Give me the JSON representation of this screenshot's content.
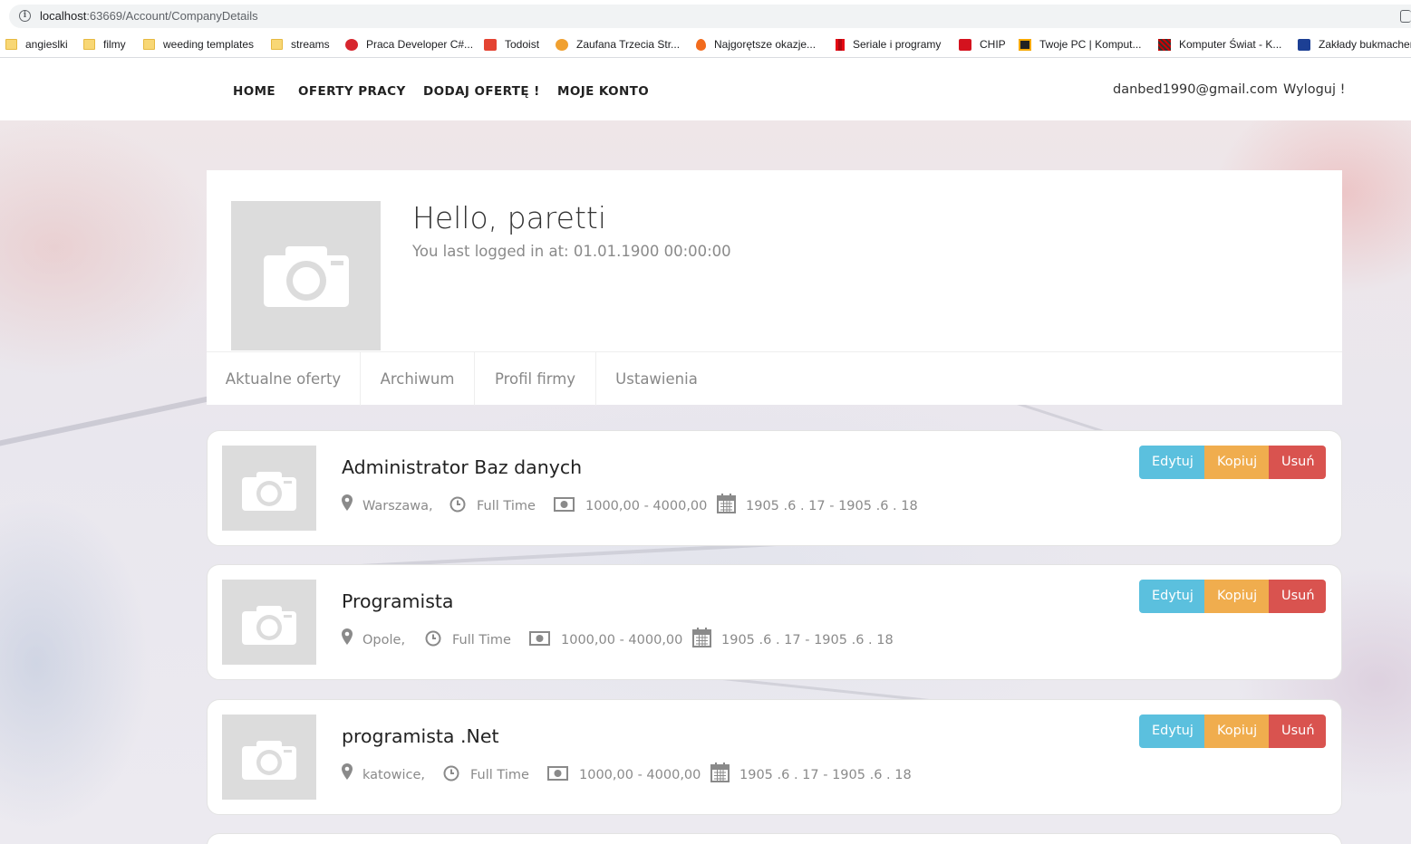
{
  "browser": {
    "url_host": "localhost",
    "url_rest": ":63669/Account/CompanyDetails",
    "bookmarks": [
      {
        "label": "angieslki",
        "icon": "folder-icon"
      },
      {
        "label": "filmy",
        "icon": "folder-icon"
      },
      {
        "label": "weeding templates",
        "icon": "folder-icon"
      },
      {
        "label": "streams",
        "icon": "folder-icon"
      },
      {
        "label": "Praca Developer C#...",
        "icon": "praca-favicon"
      },
      {
        "label": "Todoist",
        "icon": "todoist-favicon"
      },
      {
        "label": "Zaufana Trzecia Str...",
        "icon": "shield-favicon"
      },
      {
        "label": "Najgorętsze okazje...",
        "icon": "flame-favicon"
      },
      {
        "label": "Seriale i programy",
        "icon": "netflix-favicon"
      },
      {
        "label": "CHIP",
        "icon": "chip-favicon"
      },
      {
        "label": "Twoje PC | Komput...",
        "icon": "twojepc-favicon"
      },
      {
        "label": "Komputer Świat - K...",
        "icon": "komputerswiat-favicon"
      },
      {
        "label": "Zakłady bukmacher",
        "icon": "sts-favicon"
      }
    ]
  },
  "nav": {
    "home": "HOME",
    "offers": "OFERTY PRACY",
    "add_offer": "DODAJ OFERTĘ !",
    "my_account": "MOJE KONTO",
    "email": "danbed1990@gmail.com",
    "logout": "Wyloguj !"
  },
  "profile": {
    "greeting": "Hello, paretti",
    "last_login": "You last logged in at: 01.01.1900 00:00:00",
    "tabs": [
      "Aktualne oferty",
      "Archiwum",
      "Profil firmy",
      "Ustawienia"
    ]
  },
  "actions": {
    "edit": "Edytuj",
    "copy": "Kopiuj",
    "delete": "Usuń"
  },
  "jobs": [
    {
      "title": "Administrator Baz danych",
      "location": "Warszawa,",
      "type": "Full Time",
      "salary": "1000,00 - 4000,00",
      "dates": "1905 .6 . 17 - 1905 .6 . 18"
    },
    {
      "title": "Programista",
      "location": "Opole,",
      "type": "Full Time",
      "salary": "1000,00 - 4000,00",
      "dates": "1905 .6 . 17 - 1905 .6 . 18"
    },
    {
      "title": "programista .Net",
      "location": "katowice,",
      "type": "Full Time",
      "salary": "1000,00 - 4000,00",
      "dates": "1905 .6 . 17 - 1905 .6 . 18"
    }
  ],
  "colors": {
    "edit": "#5bc0de",
    "copy": "#f0ad4e",
    "delete": "#d9534f"
  }
}
